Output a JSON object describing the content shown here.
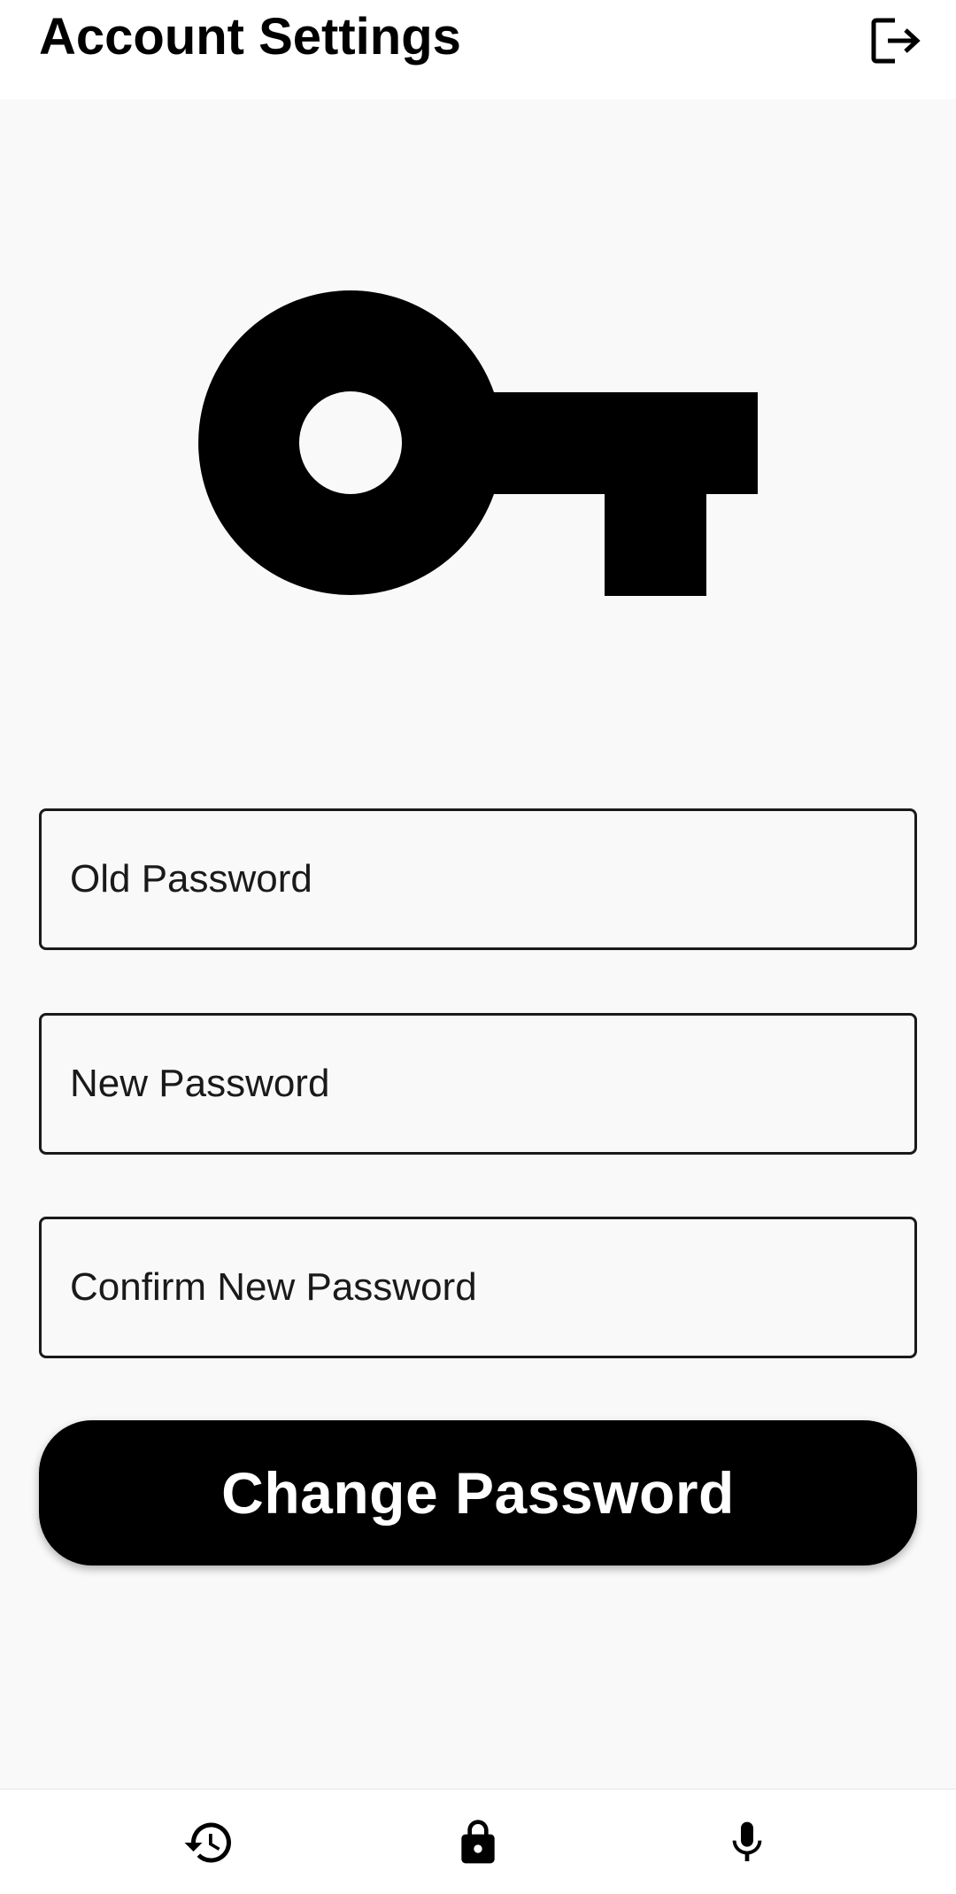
{
  "header": {
    "title": "Account Settings",
    "logout_icon": "logout-icon"
  },
  "hero": {
    "icon": "key-icon"
  },
  "form": {
    "old_password_placeholder": "Old Password",
    "new_password_placeholder": "New Password",
    "confirm_password_placeholder": "Confirm New Password",
    "submit_label": "Change Password"
  },
  "bottom_nav": {
    "items": [
      {
        "icon": "history-icon"
      },
      {
        "icon": "lock-icon"
      },
      {
        "icon": "microphone-icon"
      }
    ]
  },
  "colors": {
    "background": "#f9f9f9",
    "surface": "#ffffff",
    "primary": "#000000",
    "on_primary": "#ffffff"
  }
}
